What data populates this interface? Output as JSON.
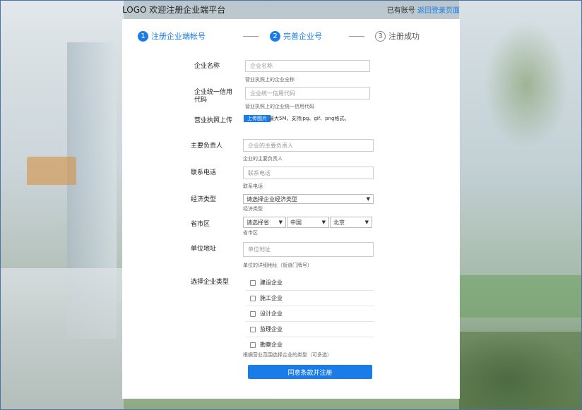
{
  "header": {
    "logo_title": "LOGO 欢迎注册企业端平台",
    "have_account": "已有账号",
    "back_login": "返回登录页面"
  },
  "steps": [
    {
      "num": "1",
      "label": "注册企业端帐号"
    },
    {
      "num": "2",
      "label": "完善企业号"
    },
    {
      "num": "3",
      "label": "注册成功"
    }
  ],
  "form": {
    "company_name": {
      "label": "企业名称",
      "placeholder": "企业名称",
      "hint": "营业执照上的企业全称"
    },
    "credit_code": {
      "label": "企业统一信用代码",
      "placeholder": "企业统一信用代码",
      "hint": "营业执照上的企业统一信用代码"
    },
    "license": {
      "label": "营业执照上传",
      "button": "上传图片",
      "note": "最大5M，支持jpg、gif、png格式。"
    },
    "principal": {
      "label": "主要负责人",
      "placeholder": "企业的主要负责人",
      "hint": "企业的主要负责人"
    },
    "phone": {
      "label": "联系电话",
      "placeholder": "联系电话",
      "hint": "联系电话"
    },
    "economy_type": {
      "label": "经济类型",
      "selected": "请选择企业经济类型",
      "hint": "经济类型"
    },
    "region": {
      "label": "省市区",
      "province": "请选择省",
      "country": "中国",
      "city": "北京",
      "hint": "省市区"
    },
    "address": {
      "label": "单位地址",
      "placeholder": "单位地址",
      "hint": "单位的详细地址（街道门牌号）"
    },
    "company_type": {
      "label": "选择企业类型",
      "options": [
        "建设企业",
        "施工企业",
        "设计企业",
        "监理企业",
        "勘察企业"
      ],
      "hint": "根据营业范围选择企业的类型（可多选）"
    },
    "submit": "同意条款并注册"
  }
}
